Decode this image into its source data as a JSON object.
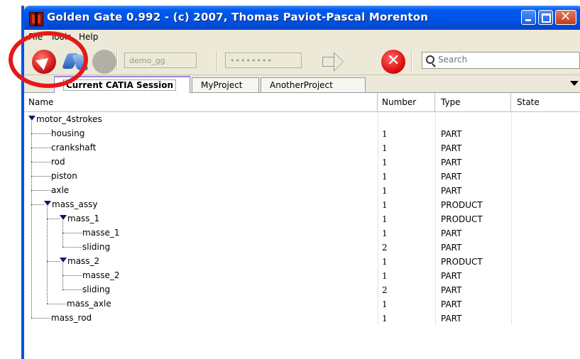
{
  "window": {
    "title": "Golden Gate 0.992 - (c) 2007, Thomas Paviot-Pascal Morenton"
  },
  "menu": {
    "file": "File",
    "tools": "Tools",
    "help": "Help"
  },
  "toolbar": {
    "login_value": "demo_gg",
    "password_value": "••••••••",
    "search_placeholder": "Search"
  },
  "tabs": [
    {
      "label": "Current CATIA Session",
      "active": true
    },
    {
      "label": "MyProject",
      "active": false
    },
    {
      "label": "AnotherProject",
      "active": false
    }
  ],
  "table": {
    "columns": [
      "Name",
      "Number",
      "Type",
      "State"
    ],
    "rows": [
      {
        "name": "motor_4strokes",
        "number": "",
        "type": "",
        "depth": 0,
        "expanded": true
      },
      {
        "name": "housing",
        "number": "1",
        "type": "PART",
        "depth": 1
      },
      {
        "name": "crankshaft",
        "number": "1",
        "type": "PART",
        "depth": 1
      },
      {
        "name": "rod",
        "number": "1",
        "type": "PART",
        "depth": 1
      },
      {
        "name": "piston",
        "number": "1",
        "type": "PART",
        "depth": 1
      },
      {
        "name": "axle",
        "number": "1",
        "type": "PART",
        "depth": 1
      },
      {
        "name": "mass_assy",
        "number": "1",
        "type": "PRODUCT",
        "depth": 1,
        "expanded": true
      },
      {
        "name": "mass_1",
        "number": "1",
        "type": "PRODUCT",
        "depth": 2,
        "expanded": true
      },
      {
        "name": "masse_1",
        "number": "1",
        "type": "PART",
        "depth": 3
      },
      {
        "name": "sliding",
        "number": "2",
        "type": "PART",
        "depth": 3
      },
      {
        "name": "mass_2",
        "number": "1",
        "type": "PRODUCT",
        "depth": 2,
        "expanded": true
      },
      {
        "name": "masse_2",
        "number": "1",
        "type": "PART",
        "depth": 3
      },
      {
        "name": "sliding",
        "number": "2",
        "type": "PART",
        "depth": 3
      },
      {
        "name": "mass_axle",
        "number": "1",
        "type": "PART",
        "depth": 2
      },
      {
        "name": "mass_rod",
        "number": "1",
        "type": "PART",
        "depth": 1
      }
    ]
  },
  "colors": {
    "titlebar": "#0054e3",
    "annotation": "#e41a1a",
    "active_tab_accent": "#8a6cd0"
  },
  "icons": [
    "app-icon",
    "connect-icon",
    "sync-icon",
    "stop-icon",
    "arrow-icon",
    "cancel-icon",
    "search-icon",
    "tab-menu-icon",
    "minimize-icon",
    "maximize-icon",
    "close-icon",
    "expand-triangle-icon"
  ]
}
